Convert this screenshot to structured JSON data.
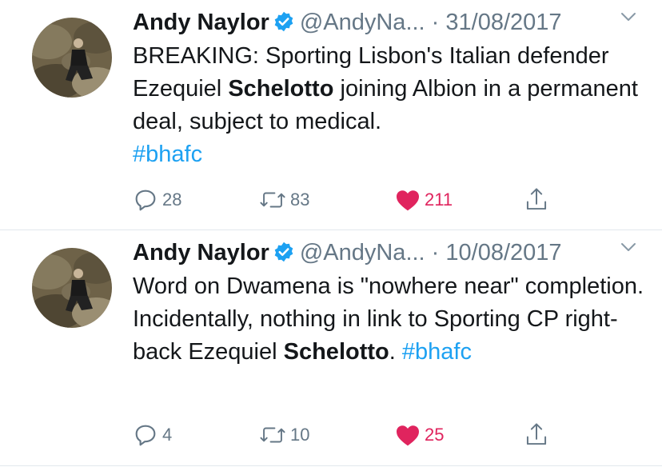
{
  "tweets": [
    {
      "name": "Andy Naylor",
      "handle": "@AndyNa...",
      "date": "· 31/08/2017",
      "text_parts": [
        "BREAKING: Sporting Lisbon's Italian defender Ezequiel ",
        "Schelotto",
        " joining Albion in a permanent deal, subject to medical.",
        "#bhafc"
      ],
      "replies": "28",
      "retweets": "83",
      "likes": "211"
    },
    {
      "name": "Andy Naylor",
      "handle": "@AndyNa...",
      "date": "· 10/08/2017",
      "text_parts": [
        "Word on Dwamena is \"nowhere near\" completion. Incidentally, nothing in link to Sporting CP right-back Ezequiel ",
        "Schelotto",
        ". ",
        "#bhafc"
      ],
      "replies": "4",
      "retweets": "10",
      "likes": "25"
    }
  ],
  "icons": {
    "verified": "verified-badge-icon",
    "chevron": "chevron-down-icon",
    "reply": "reply-icon",
    "retweet": "retweet-icon",
    "like": "heart-icon",
    "share": "share-icon"
  },
  "colors": {
    "accent": "#1da1f2",
    "like": "#e0245e",
    "meta": "#657786"
  }
}
